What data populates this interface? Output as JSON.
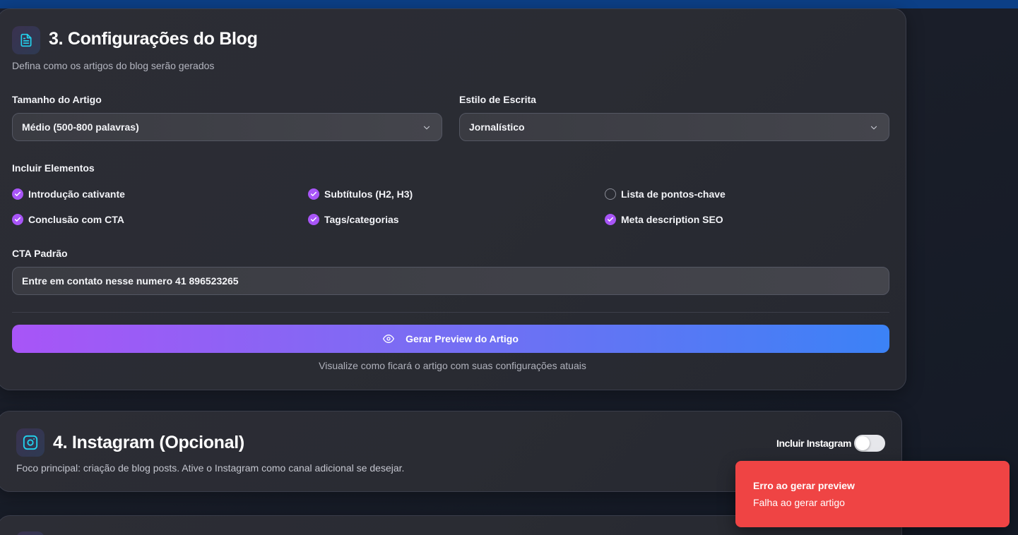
{
  "blog": {
    "title": "3. Configurações do Blog",
    "subtitle": "Defina como os artigos do blog serão gerados",
    "size": {
      "label": "Tamanho do Artigo",
      "value": "Médio (500-800 palavras)"
    },
    "style": {
      "label": "Estilo de Escrita",
      "value": "Jornalístico"
    },
    "elements_label": "Incluir Elementos",
    "elements": [
      {
        "label": "Introdução cativante",
        "checked": true
      },
      {
        "label": "Subtítulos (H2, H3)",
        "checked": true
      },
      {
        "label": "Lista de pontos-chave",
        "checked": false
      },
      {
        "label": "Conclusão com CTA",
        "checked": true
      },
      {
        "label": "Tags/categorias",
        "checked": true
      },
      {
        "label": "Meta description SEO",
        "checked": true
      }
    ],
    "cta": {
      "label": "CTA Padrão",
      "value": "Entre em contato nesse numero 41 896523265"
    },
    "preview_button": "Gerar Preview do Artigo",
    "preview_hint": "Visualize como ficará o artigo com suas configurações atuais"
  },
  "instagram": {
    "title": "4. Instagram (Opcional)",
    "subtitle": "Foco principal: criação de blog posts. Ative o Instagram como canal adicional se desejar.",
    "toggle_label": "Incluir Instagram",
    "enabled": false
  },
  "toast": {
    "title": "Erro ao gerar preview",
    "message": "Falha ao gerar artigo"
  },
  "colors": {
    "accent": "#a855f7",
    "gradient_end": "#3b82f6",
    "error": "#ef4444",
    "icon_cyan": "#22d3ee"
  }
}
